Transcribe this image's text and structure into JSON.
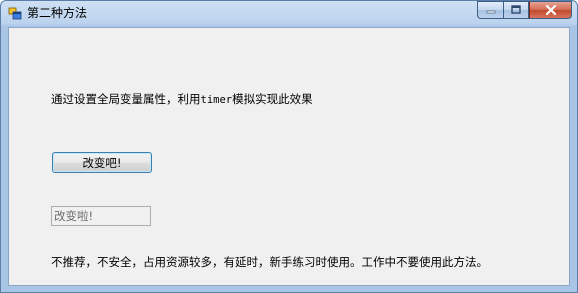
{
  "window": {
    "title": "第二种方法"
  },
  "labels": {
    "description_prefix": "通过设置全局变量属性，利用",
    "description_code": "timer",
    "description_suffix": "模拟实现此效果",
    "note": "不推荐，不安全，占用资源较多，有延时，新手练习时使用。工作中不要使用此方法。"
  },
  "button": {
    "label": "改变吧!"
  },
  "textbox": {
    "value": "改变啦!"
  },
  "colors": {
    "titlebar": "#bcd3ee",
    "client_background": "#f0f0f0",
    "close_button": "#c14a2f"
  },
  "icons": {
    "app": "app-window-icon",
    "minimize": "minimize-icon",
    "maximize": "maximize-icon",
    "close": "close-icon"
  }
}
